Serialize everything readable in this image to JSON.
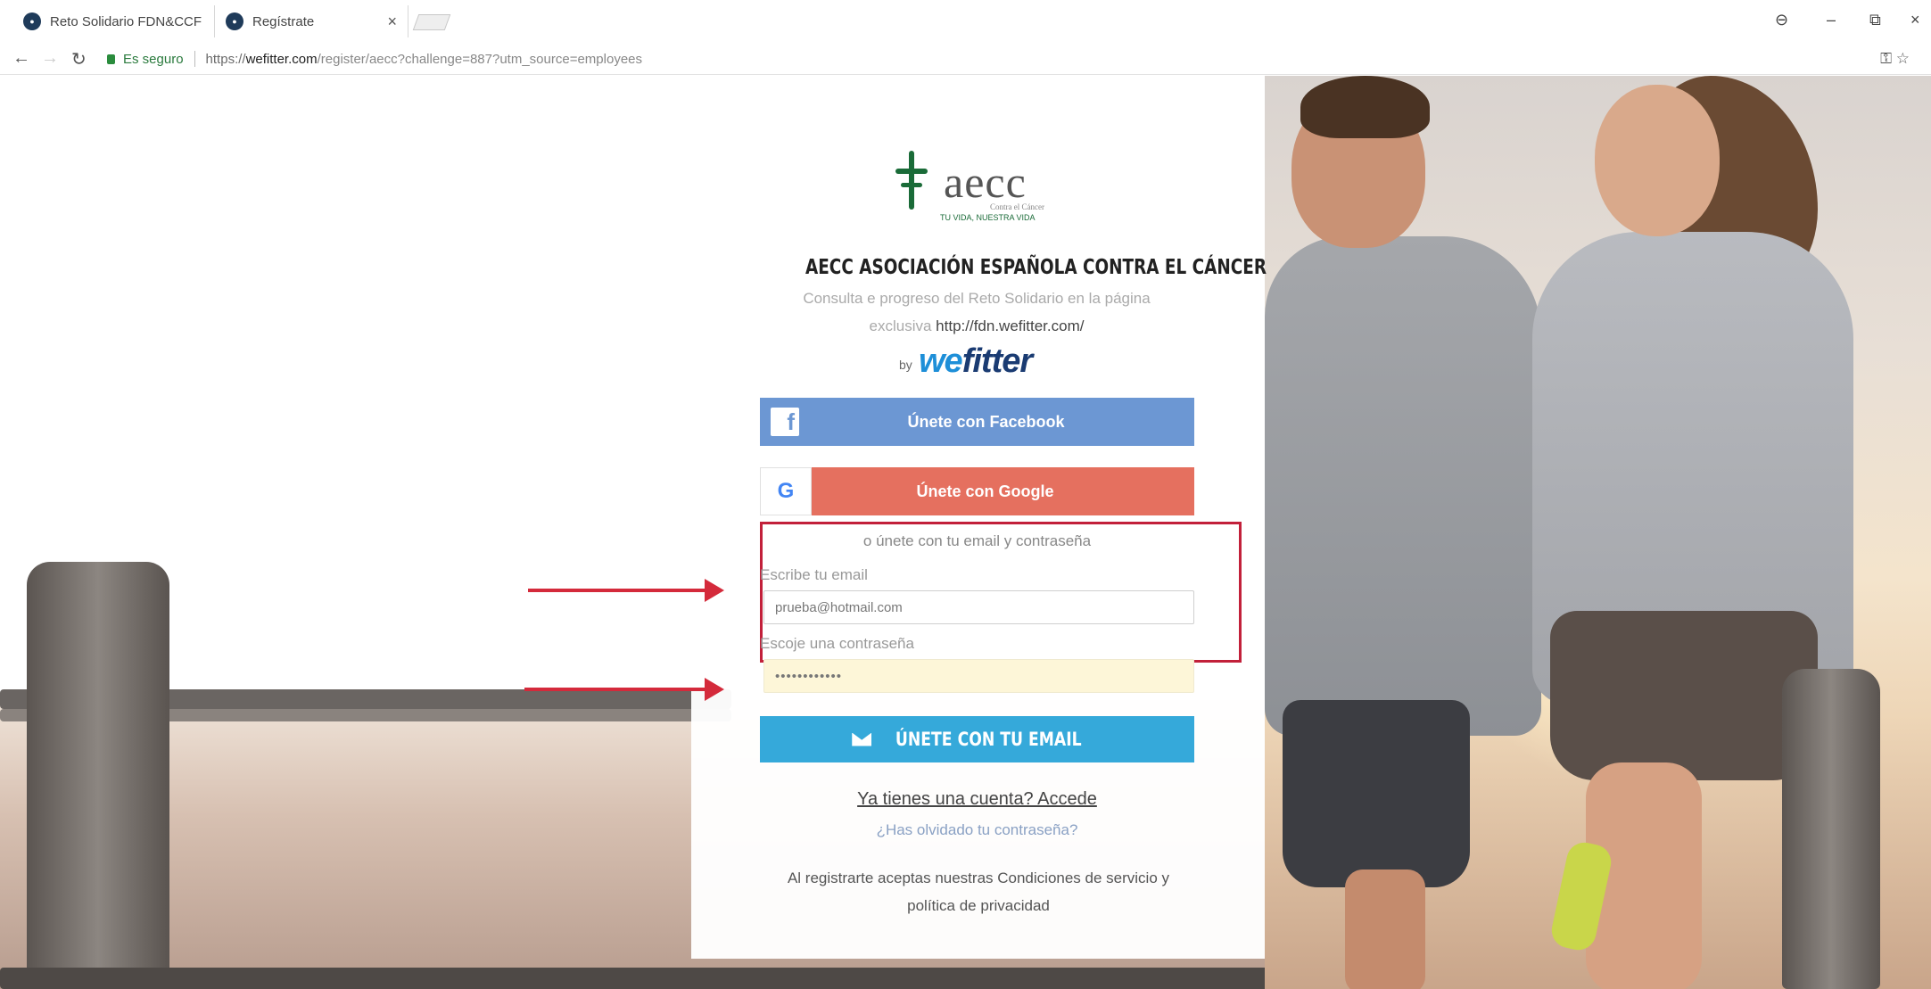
{
  "browser": {
    "tabs": [
      {
        "title": "Reto Solidario FDN&CCF",
        "favicon": "wefitter-favicon",
        "active": false
      },
      {
        "title": "Regístrate",
        "favicon": "wefitter-favicon",
        "active": true
      }
    ],
    "tab_close_glyph": "×",
    "window_controls": {
      "profile": "⊖",
      "minimize": "–",
      "restore": "⧉",
      "close": "×"
    },
    "security_label": "Es seguro",
    "url": {
      "prefix": "https://",
      "host": "wefitter.com",
      "path": "/register/aecc?challenge=887?utm_source=employees"
    }
  },
  "logo": {
    "word": "aecc",
    "tagline_small": "Contra el Cáncer",
    "tagline": "TU VIDA, NUESTRA VIDA"
  },
  "heading": {
    "title": "AECC ASOCIACIÓN ESPAÑOLA CONTRA EL CÁNCER",
    "line1": "Consulta e progreso del Reto Solidario en la página",
    "line2_prefix": "exclusiva",
    "line2_link": "http://fdn.wefitter.com/"
  },
  "powered_by": {
    "by": "by",
    "brand_we": "we",
    "brand_fitter": "fitter"
  },
  "social": {
    "facebook_icon": "f",
    "facebook_label": "Únete con Facebook",
    "google_icon": "G",
    "google_label": "Únete con Google"
  },
  "form": {
    "divider": "o únete con tu email y contraseña",
    "email_label": "Escribe tu email",
    "email_value": "prueba@hotmail.com",
    "password_label": "Escoje una contraseña",
    "password_value": "••••••••••••",
    "submit_label": "ÚNETE CON TU EMAIL"
  },
  "footer": {
    "login_link": "Ya tienes una cuenta? Accede",
    "forgot_link": "¿Has olvidado tu contraseña?",
    "terms_line1": "Al registrarte aceptas nuestras Condiciones de servicio y",
    "terms_line2": "política de privacidad"
  },
  "colors": {
    "facebook": "#6c97d3",
    "google": "#e5705f",
    "email_button": "#35a9da",
    "annotation_red": "#c2203a",
    "aecc_green": "#1a6b38",
    "wefitter_navy": "#1a3b72"
  }
}
